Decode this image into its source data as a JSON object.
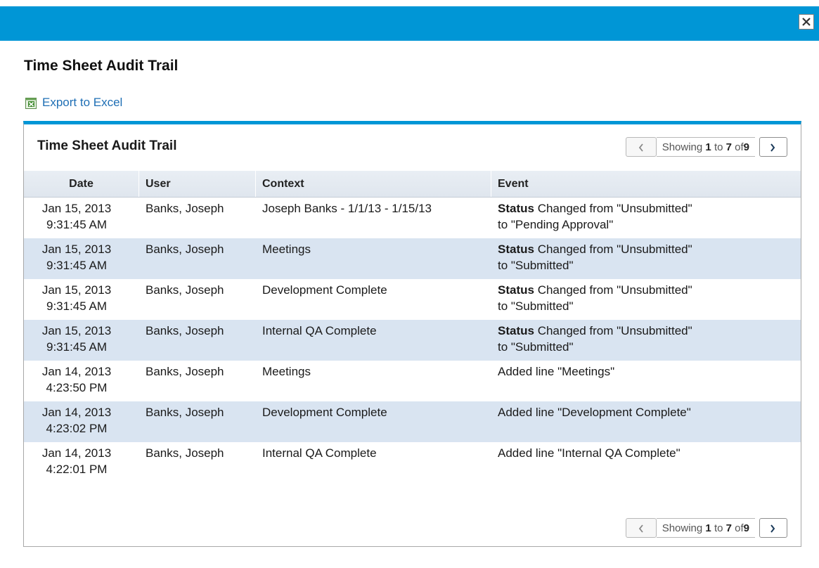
{
  "dialog": {
    "close_label": "×"
  },
  "page_title": "Time Sheet Audit Trail",
  "export": {
    "label": "Export to Excel",
    "icon": "excel-icon"
  },
  "panel": {
    "title": "Time Sheet Audit Trail",
    "pagination": {
      "prefix": "Showing",
      "from": "1",
      "to_word": "to",
      "to": "7",
      "of_word": "of",
      "total": "9"
    }
  },
  "table": {
    "columns": [
      "Date",
      "User",
      "Context",
      "Event"
    ],
    "rows": [
      {
        "date": "Jan 15, 2013",
        "time": "9:31:45 AM",
        "user": "Banks, Joseph",
        "context": "Joseph Banks - 1/1/13 - 1/15/13",
        "event_bold": "Status",
        "event_line1": " Changed from \"Unsubmitted\"",
        "event_line2": "to \"Pending Approval\""
      },
      {
        "date": "Jan 15, 2013",
        "time": "9:31:45 AM",
        "user": "Banks, Joseph",
        "context": "Meetings",
        "event_bold": "Status",
        "event_line1": " Changed from \"Unsubmitted\"",
        "event_line2": "to \"Submitted\""
      },
      {
        "date": "Jan 15, 2013",
        "time": "9:31:45 AM",
        "user": "Banks, Joseph",
        "context": "Development Complete",
        "event_bold": "Status",
        "event_line1": " Changed from \"Unsubmitted\"",
        "event_line2": "to \"Submitted\""
      },
      {
        "date": "Jan 15, 2013",
        "time": "9:31:45 AM",
        "user": "Banks, Joseph",
        "context": "Internal QA Complete",
        "event_bold": "Status",
        "event_line1": " Changed from \"Unsubmitted\"",
        "event_line2": "to \"Submitted\""
      },
      {
        "date": "Jan 14, 2013",
        "time": "4:23:50 PM",
        "user": "Banks, Joseph",
        "context": "Meetings",
        "event_bold": "",
        "event_line1": "Added line \"Meetings\"",
        "event_line2": ""
      },
      {
        "date": "Jan 14, 2013",
        "time": "4:23:02 PM",
        "user": "Banks, Joseph",
        "context": "Development Complete",
        "event_bold": "",
        "event_line1": "Added line \"Development Complete\"",
        "event_line2": ""
      },
      {
        "date": "Jan 14, 2013",
        "time": "4:22:01 PM",
        "user": "Banks, Joseph",
        "context": "Internal QA Complete",
        "event_bold": "",
        "event_line1": "Added line \"Internal QA Complete\"",
        "event_line2": ""
      }
    ]
  },
  "colors": {
    "accent": "#0096d6",
    "alt_row": "#d9e4f1",
    "link": "#1f6fb5"
  }
}
